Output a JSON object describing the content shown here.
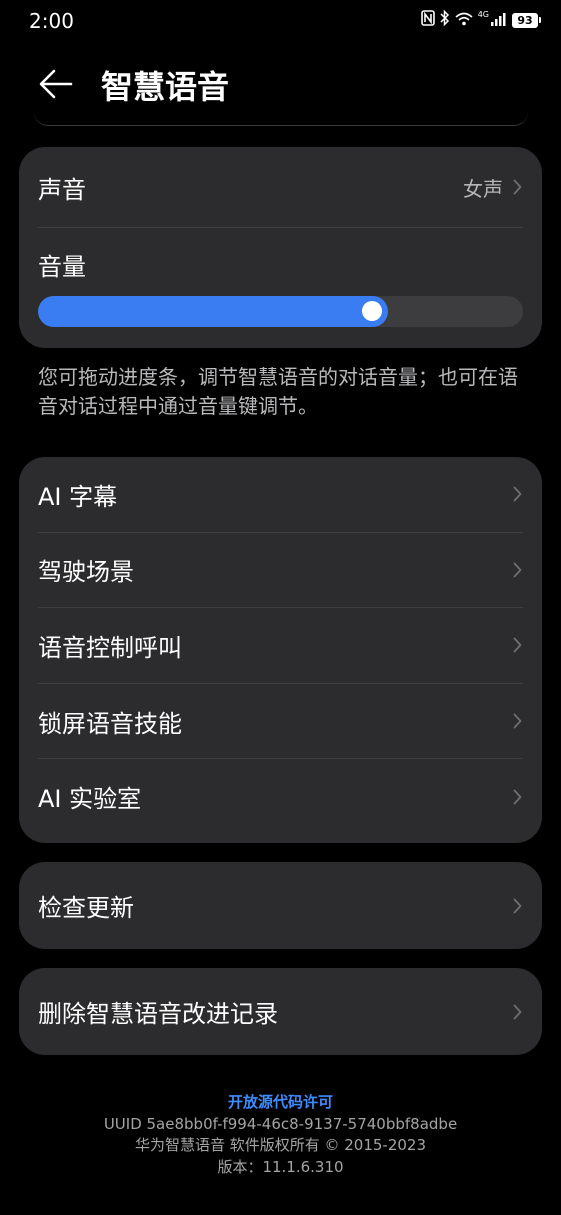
{
  "status_bar": {
    "time": "2:00",
    "network": "4G",
    "battery": "93",
    "icons": [
      "nfc-icon",
      "bluetooth-icon",
      "wifi-icon",
      "signal-icon",
      "battery-icon"
    ]
  },
  "header": {
    "title": "智慧语音",
    "back_icon": "back-arrow-icon"
  },
  "voice_card": {
    "voice_label": "声音",
    "voice_value": "女声",
    "volume_label": "音量",
    "volume_level": 0.722,
    "accent_color": "#3a7cf2"
  },
  "hint": "您可拖动进度条，调节智慧语音的对话音量；也可在语音对话过程中通过音量键调节。",
  "menu": [
    {
      "label": "AI 字幕"
    },
    {
      "label": "驾驶场景"
    },
    {
      "label": "语音控制呼叫"
    },
    {
      "label": "锁屏语音技能"
    },
    {
      "label": "AI 实验室"
    }
  ],
  "check_update": "检查更新",
  "delete_records": "删除智慧语音改进记录",
  "footer": {
    "oss_link": "开放源代码许可",
    "uuid": "UUID 5ae8bb0f-f994-46c8-9137-5740bbf8adbe",
    "copyright": "华为智慧语音 软件版权所有 © 2015-2023",
    "version": "版本：11.1.6.310"
  }
}
